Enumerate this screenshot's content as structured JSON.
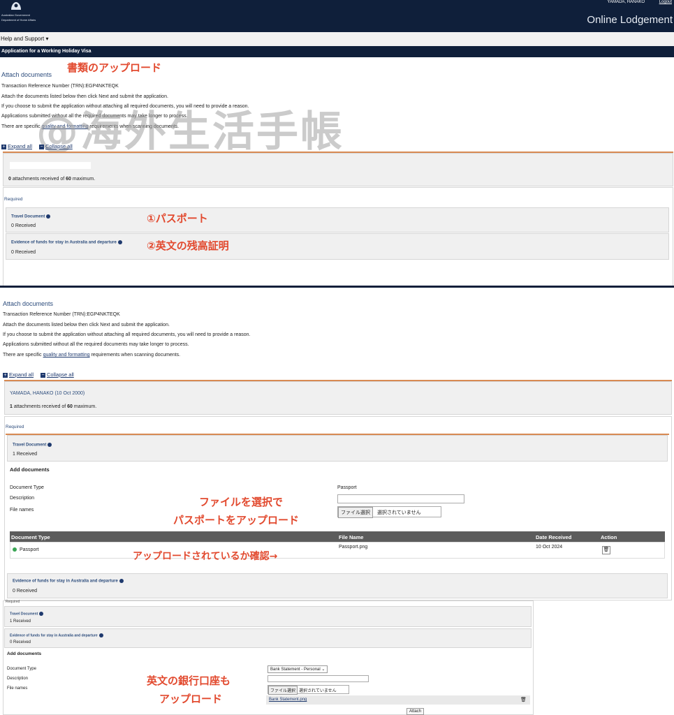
{
  "header": {
    "gov_name": "Australian Government",
    "dept_name": "Department of Home Affairs",
    "user_name": "YAMADA, HANAKO",
    "logout": "Logout",
    "online_lodgement": "Online Lodgement",
    "help_support": "Help and Support ▾",
    "app_title": "Application for a Working Holiday Visa"
  },
  "watermark": "@海外生活手帳",
  "panel1": {
    "heading": "Attach documents",
    "annotation": "書類のアップロード",
    "trn": "Transaction Reference Number (TRN):EGP4NKTEQK",
    "line1": "Attach the documents listed below then click Next and submit the application.",
    "line2": "If you choose to submit the application without attaching all required documents, you will need to provide a reason.",
    "line3": "Applications submitted without all the required documents may take longer to process.",
    "line4_pre": "There are specific ",
    "line4_link": "quality and formatting",
    "line4_post": " requirements when scanning documents.",
    "expand_all": "Expand all",
    "collapse_all": "Collapse all",
    "attachments_count": "0",
    "attachments_text": " attachments received of ",
    "attachments_max": "60",
    "attachments_suffix": " maximum.",
    "required": "Required",
    "travel_doc": "Travel Document",
    "travel_received": "0 Received",
    "travel_annotation": "①パスポート",
    "funds": "Evidence of funds for stay in Australia and departure",
    "funds_received": "0 Received",
    "funds_annotation": "②英文の残高証明"
  },
  "panel2": {
    "heading": "Attach documents",
    "trn": "Transaction Reference Number (TRN):EGP4NKTEQK",
    "line1": "Attach the documents listed below then click Next and submit the application.",
    "line2": "If you choose to submit the application without attaching all required documents, you will need to provide a reason.",
    "line3": "Applications submitted without all the required documents may take longer to process.",
    "line4_pre": "There are specific ",
    "line4_link": "quality and formatting",
    "line4_post": " requirements when scanning documents.",
    "expand_all": "Expand all",
    "collapse_all": "Collapse all",
    "applicant": "YAMADA, HANAKO (10 Oct 2000)",
    "attachments_count": "1",
    "attachments_text": " attachments received of ",
    "attachments_max": "60",
    "attachments_suffix": " maximum.",
    "required": "Required",
    "travel_doc": "Travel Document",
    "travel_received": "1 Received",
    "add_documents": "Add documents",
    "doc_type_label": "Document Type",
    "doc_type_value": "Passport",
    "description_label": "Description",
    "file_names_label": "File names",
    "choose_file": "ファイル選択",
    "no_file": "選択されていません",
    "annotation_select_1": "ファイルを選択で",
    "annotation_select_2": "パスポートをアップロード",
    "table_headers": [
      "Document Type",
      "File Name",
      "Date Received",
      "Action"
    ],
    "row_type": "Passport",
    "row_file": "Passport.png",
    "row_date": "10 Oct 2024",
    "annotation_confirm": "アップロードされているか確認→",
    "funds": "Evidence of funds for stay in Australia and departure",
    "funds_received": "0 Received"
  },
  "panel3": {
    "required": "Required",
    "travel_doc": "Travel Document",
    "travel_received": "1 Received",
    "funds": "Evidence of funds for stay in Australia and departure",
    "funds_received": "0 Received",
    "add_documents": "Add documents",
    "doc_type_label": "Document Type",
    "doc_type_value": "Bank Statement - Personal",
    "description_label": "Description",
    "file_names_label": "File names",
    "choose_file": "ファイル選択",
    "no_file": "選択されていません",
    "file_link": "Bank Statement.png",
    "attach": "Attach",
    "annotation_1": "英文の銀行口座も",
    "annotation_2": "アップロード"
  },
  "colors": {
    "navy": "#0f1f3a",
    "accent_orange": "#d88a52",
    "annotation_red": "#e24a2f",
    "link_blue": "#1f3a6e",
    "status_green": "#3aa655"
  }
}
